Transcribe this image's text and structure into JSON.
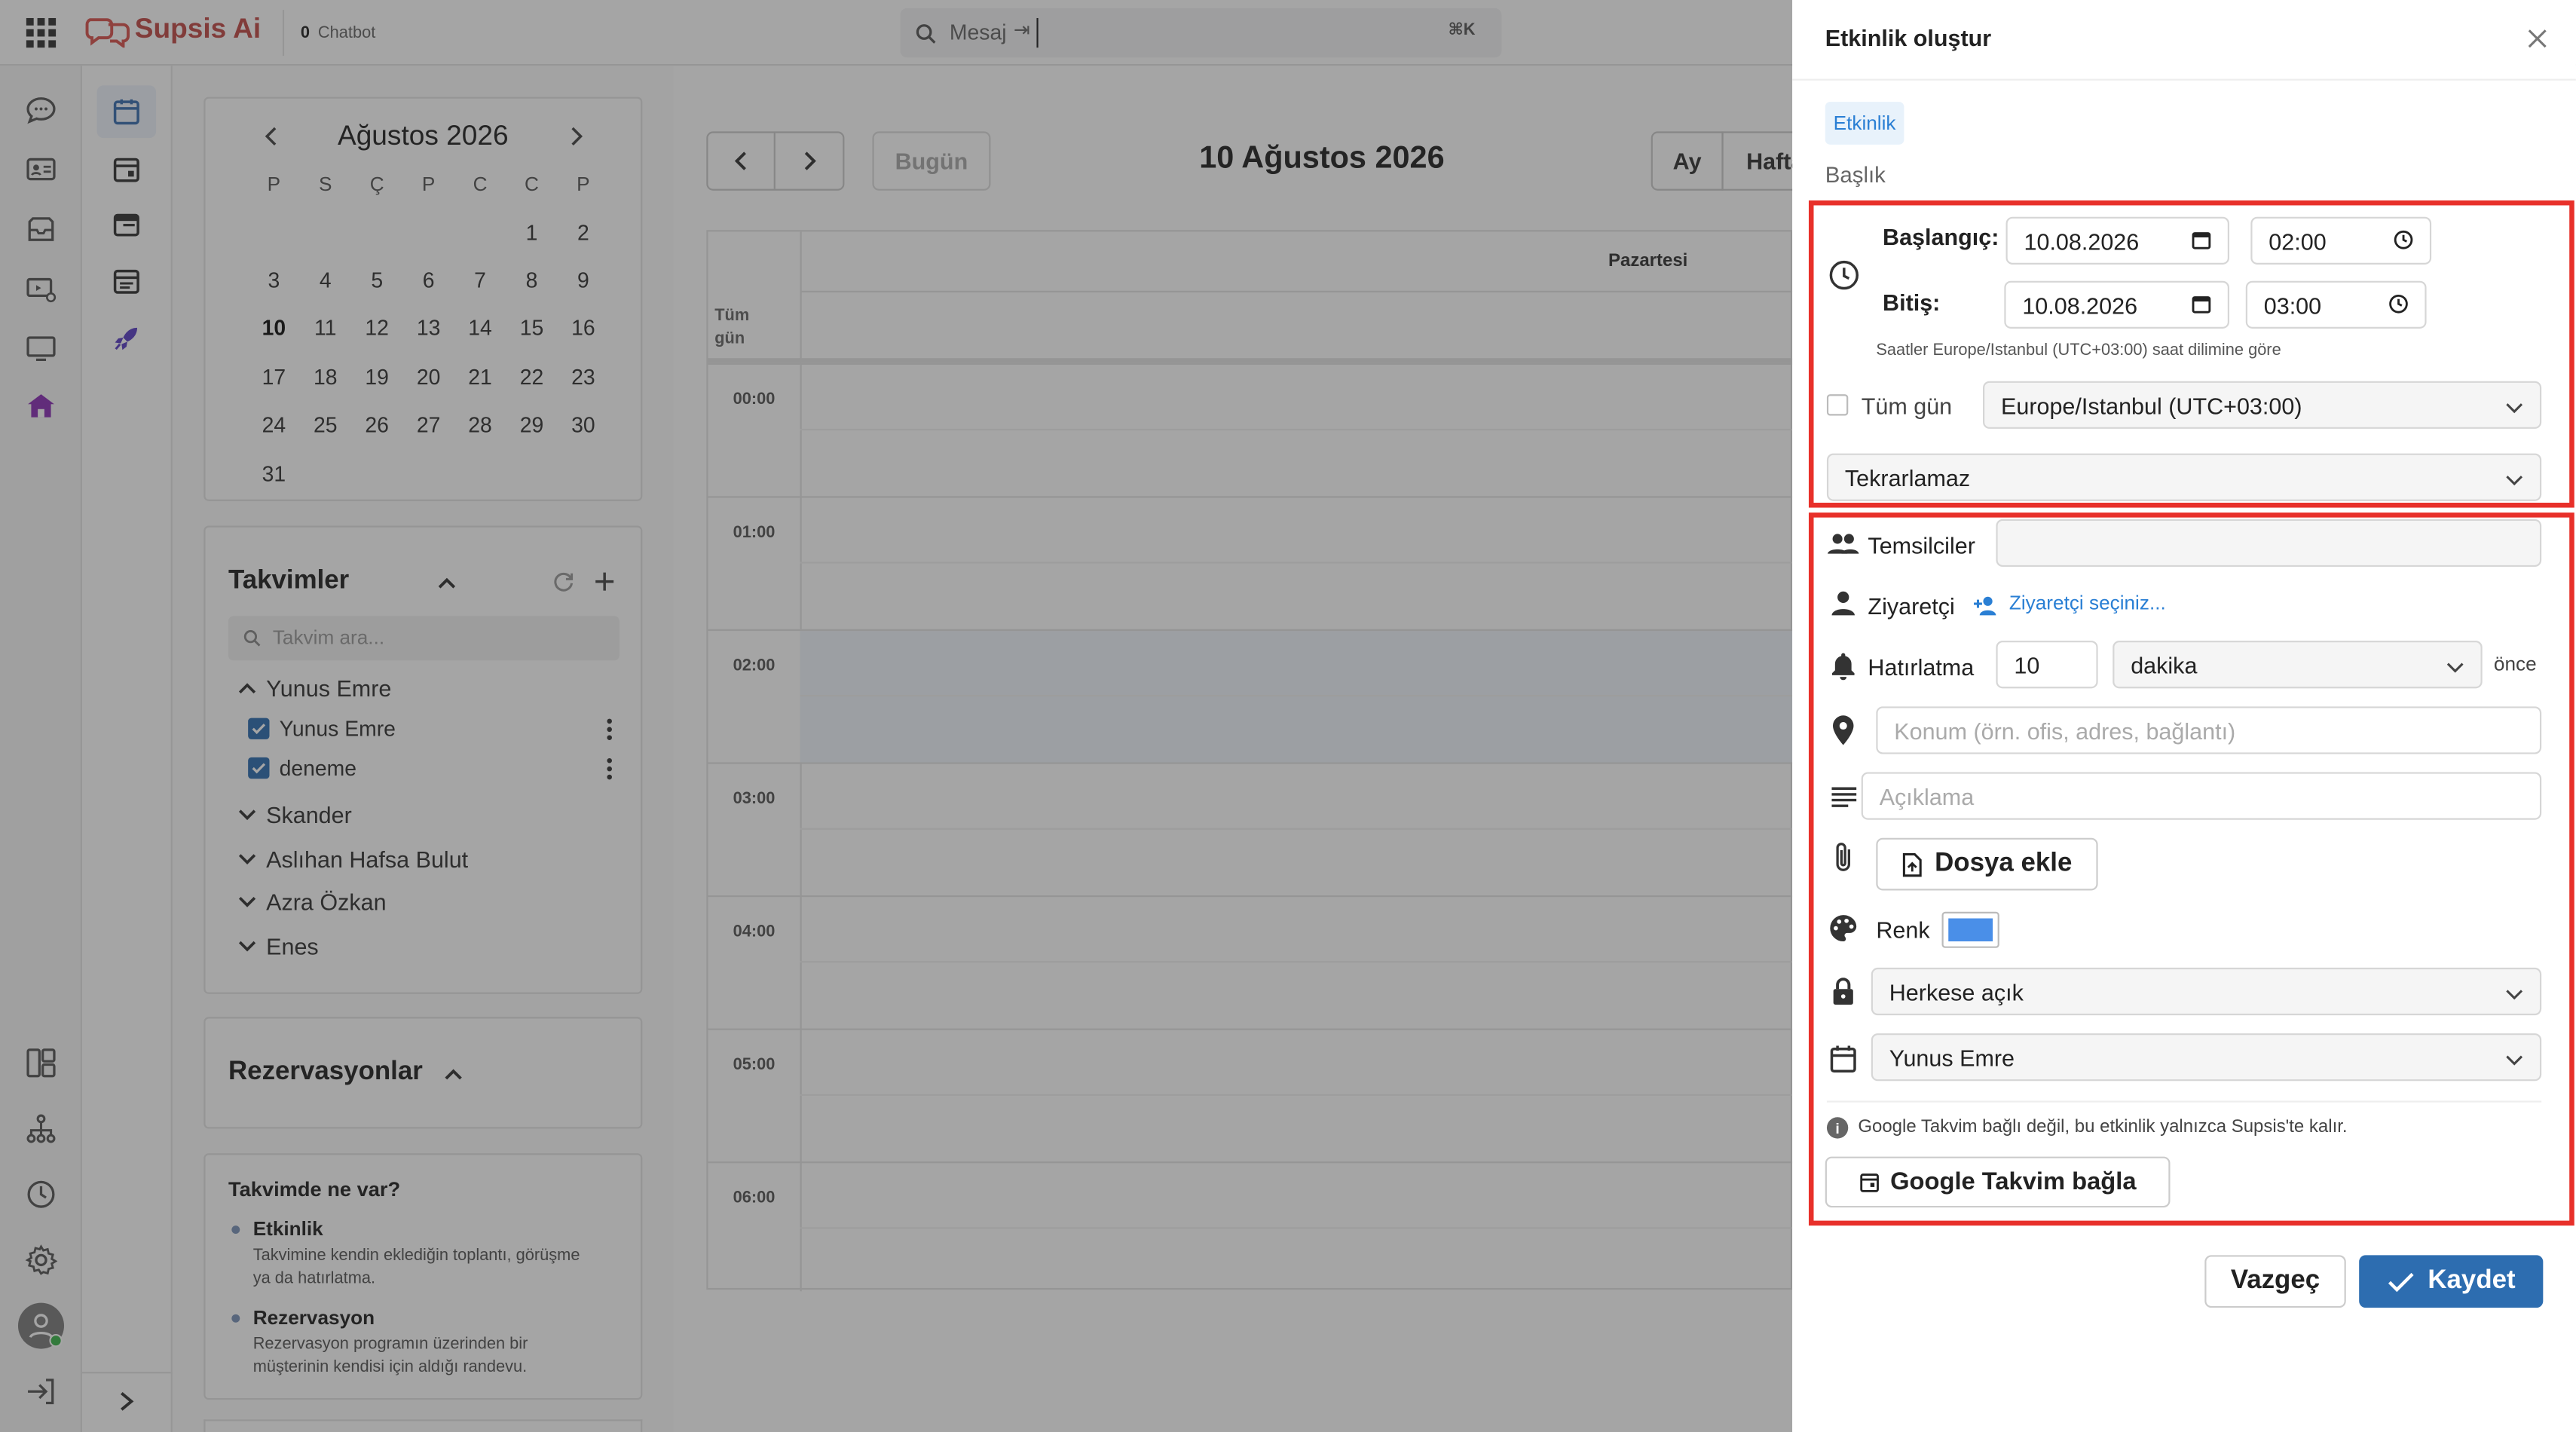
{
  "app": {
    "brand": "Supsis Ai",
    "chatbot_count": "0",
    "chatbot_label": "Chatbot"
  },
  "search": {
    "placeholder": "Mesaj",
    "shortcut": "⌘K"
  },
  "mini_calendar": {
    "month_title": "Ağustos 2026",
    "weekdays": [
      "P",
      "S",
      "Ç",
      "P",
      "C",
      "C",
      "P"
    ],
    "weeks": [
      [
        "",
        "",
        "",
        "",
        "",
        "1",
        "2"
      ],
      [
        "3",
        "4",
        "5",
        "6",
        "7",
        "8",
        "9"
      ],
      [
        "10",
        "11",
        "12",
        "13",
        "14",
        "15",
        "16"
      ],
      [
        "17",
        "18",
        "19",
        "20",
        "21",
        "22",
        "23"
      ],
      [
        "24",
        "25",
        "26",
        "27",
        "28",
        "29",
        "30"
      ],
      [
        "31",
        "",
        "",
        "",
        "",
        "",
        ""
      ]
    ],
    "selected_day": "10"
  },
  "calendars": {
    "title": "Takvimler",
    "search_placeholder": "Takvim ara...",
    "groups": [
      {
        "name": "Yunus Emre",
        "expanded": true,
        "items": [
          {
            "label": "Yunus Emre",
            "checked": true
          },
          {
            "label": "deneme",
            "checked": true
          }
        ]
      },
      {
        "name": "Skander"
      },
      {
        "name": "Aslıhan Hafsa Bulut"
      },
      {
        "name": "Azra Özkan"
      },
      {
        "name": "Enes"
      }
    ]
  },
  "reservations": {
    "title": "Rezervasyonlar"
  },
  "info_card": {
    "title": "Takvimde ne var?",
    "items": [
      {
        "title": "Etkinlik",
        "desc": "Takvimine kendin eklediğin toplantı, görüşme ya da hatırlatma."
      },
      {
        "title": "Rezervasyon",
        "desc": "Rezervasyon programın üzerinden bir müşterinin kendisi için aldığı randevu."
      }
    ]
  },
  "main_calendar": {
    "title": "10 Ağustos 2026",
    "today_label": "Bugün",
    "view_month": "Ay",
    "view_week": "Hafta",
    "day_header": "Pazartesi",
    "all_day": "Tüm gün",
    "hours": [
      "00:00",
      "01:00",
      "02:00",
      "03:00",
      "04:00",
      "05:00",
      "06:00"
    ]
  },
  "panel": {
    "title": "Etkinlik oluştur",
    "type_tag": "Etkinlik",
    "title_placeholder": "Başlık",
    "start_label": "Başlangıç:",
    "start_date": "10.08.2026",
    "start_time": "02:00",
    "end_label": "Bitiş:",
    "end_date": "10.08.2026",
    "end_time": "03:00",
    "tz_note": "Saatler Europe/Istanbul (UTC+03:00) saat dilimine göre",
    "all_day_label": "Tüm gün",
    "timezone": "Europe/Istanbul (UTC+03:00)",
    "repeat": "Tekrarlamaz",
    "reps_label": "Temsilciler",
    "visitor_label": "Ziyaretçi",
    "visitor_link": "Ziyaretçi seçiniz...",
    "reminder_label": "Hatırlatma",
    "reminder_value": "10",
    "reminder_unit": "dakika",
    "reminder_suffix": "önce",
    "location_placeholder": "Konum (örn. ofis, adres, bağlantı)",
    "description_placeholder": "Açıklama",
    "attach_label": "Dosya ekle",
    "color_label": "Renk",
    "color_value": "#4a8fe8",
    "visibility": "Herkese açık",
    "calendar": "Yunus Emre",
    "google_note": "Google Takvim bağlı değil, bu etkinlik yalnızca Supsis'te kalır.",
    "google_button": "Google Takvim bağla",
    "cancel": "Vazgeç",
    "save": "Kaydet"
  },
  "colors": {
    "accent": "#2d6db0",
    "highlight": "#e8302a",
    "brand": "#d9534f",
    "link": "#2a7fd4"
  }
}
